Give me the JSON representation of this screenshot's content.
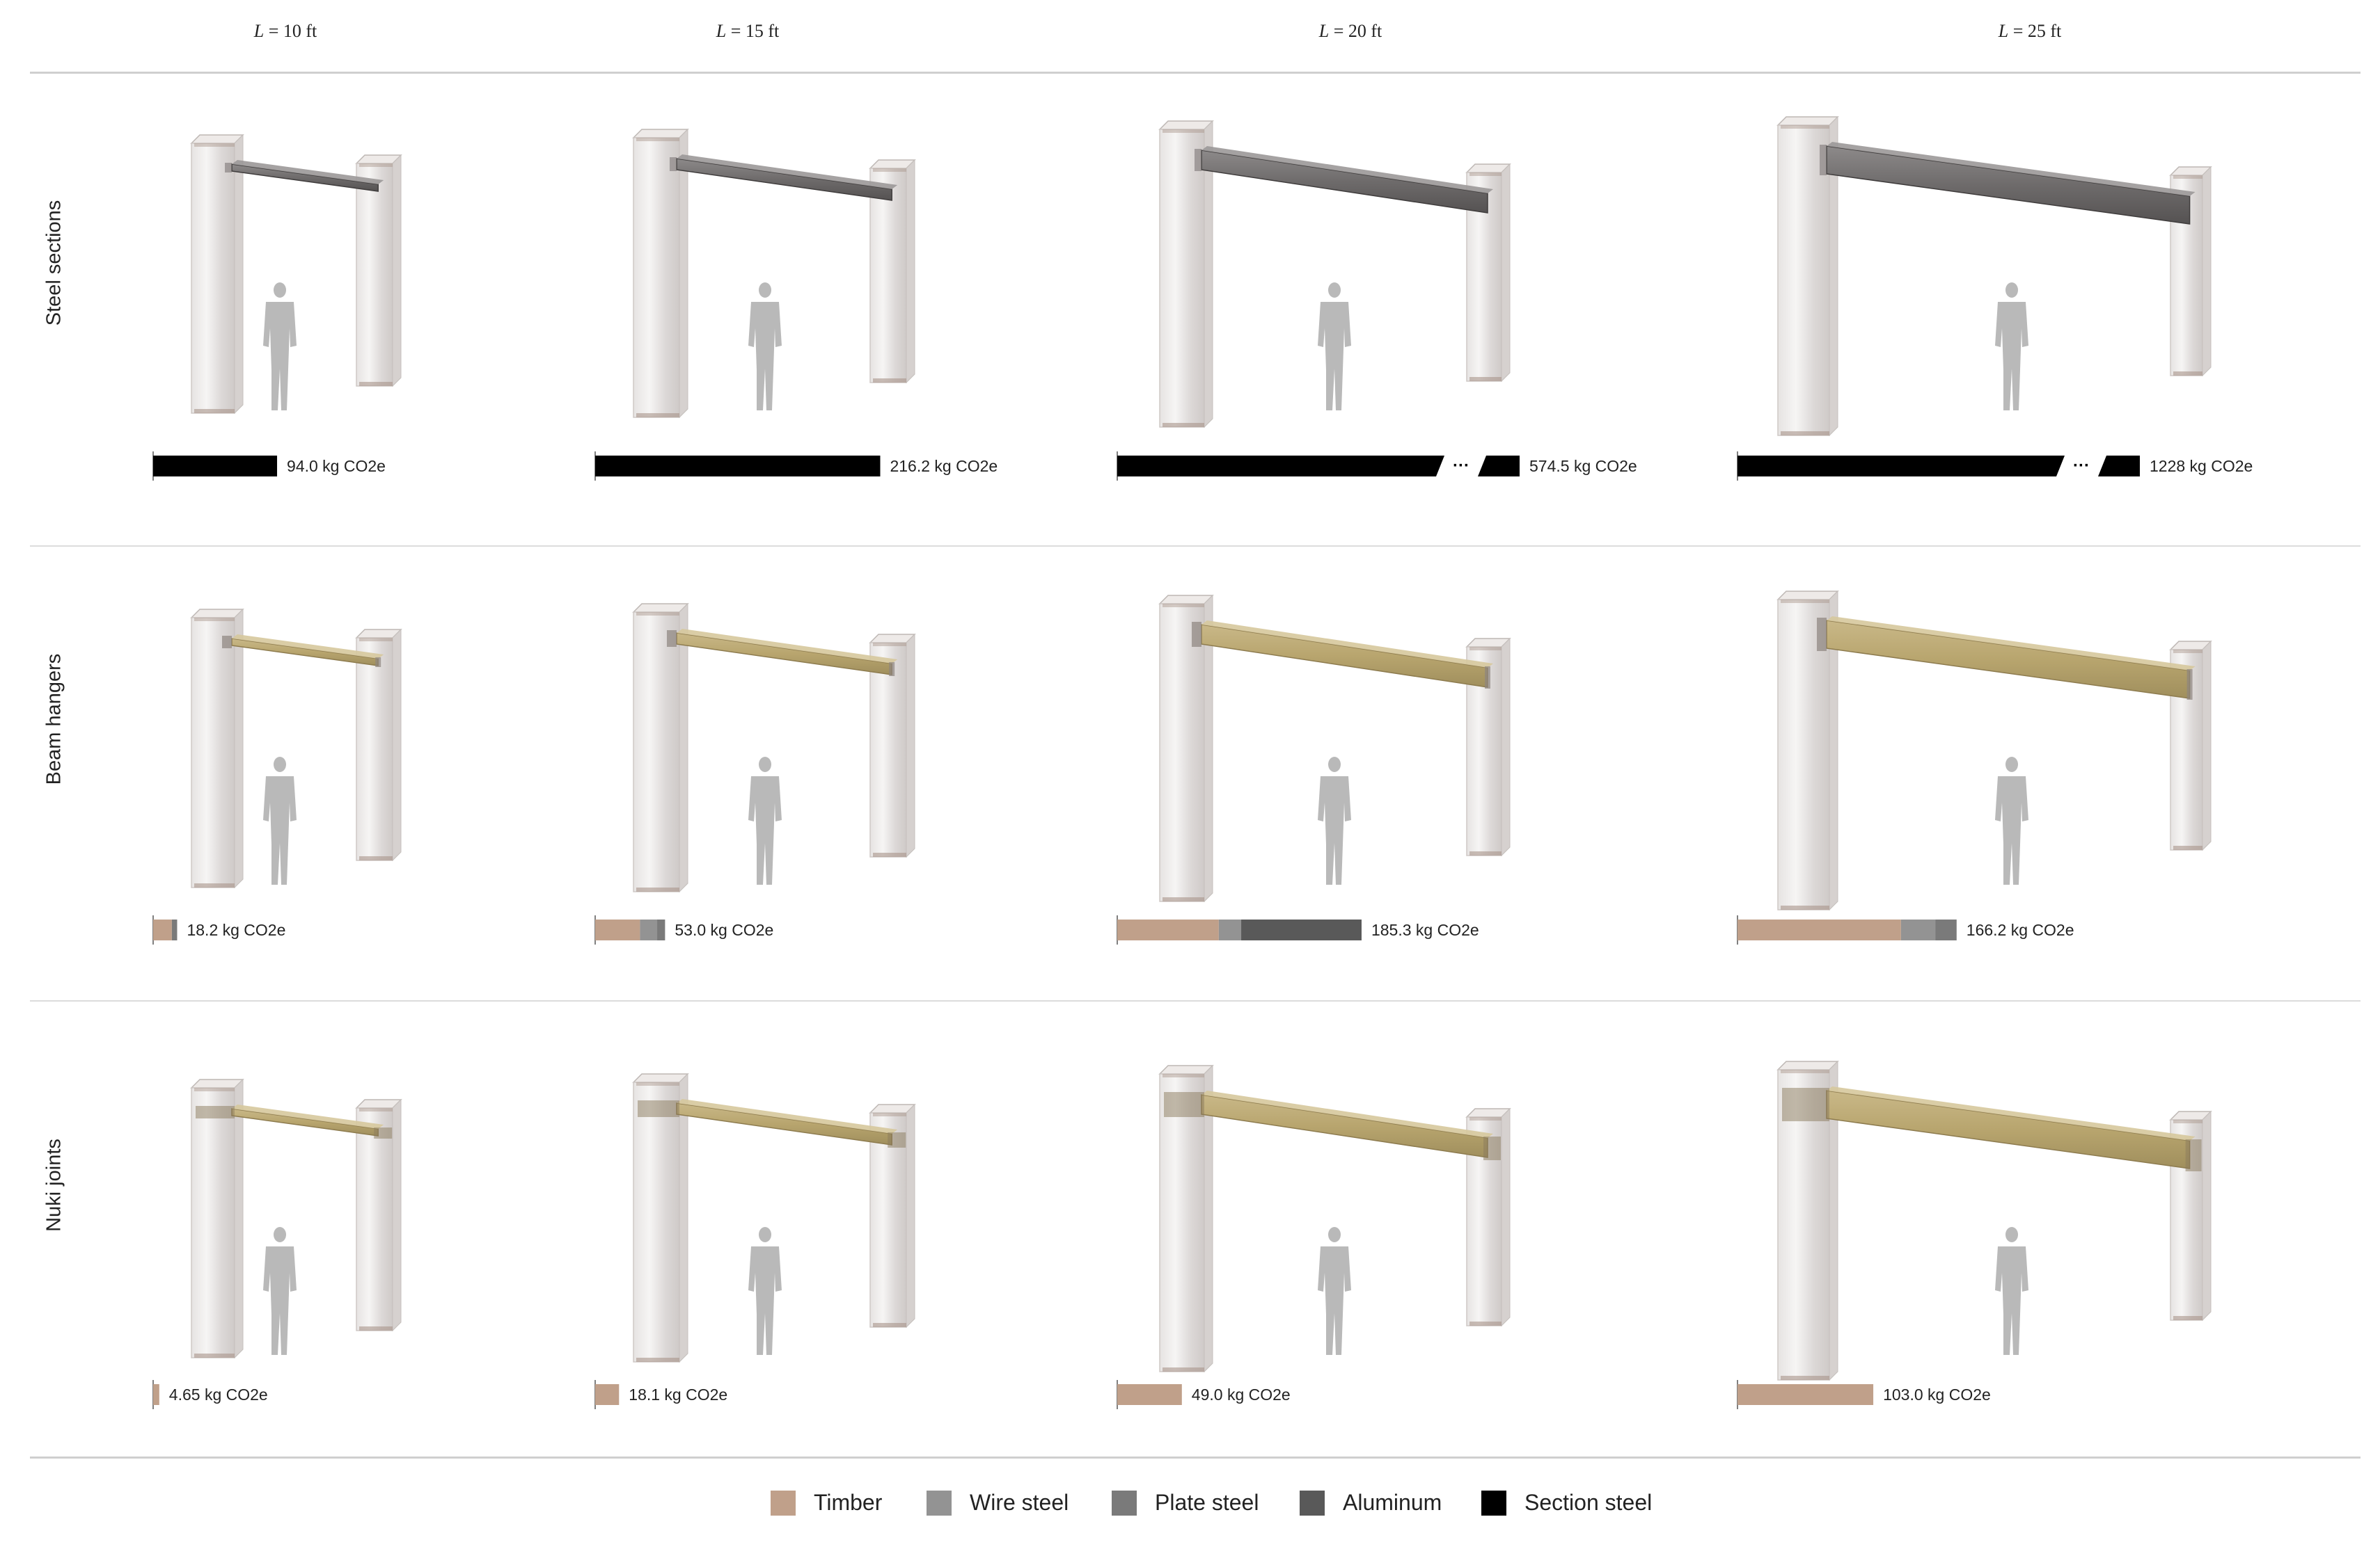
{
  "chart_data": {
    "type": "bar",
    "title": "",
    "columns": [
      {
        "prefix": "L",
        "value": " = 10 ft"
      },
      {
        "prefix": "L",
        "value": " = 15 ft"
      },
      {
        "prefix": "L",
        "value": " = 20 ft"
      },
      {
        "prefix": "L",
        "value": " = 25 ft"
      }
    ],
    "rows": [
      {
        "label": "Steel sections",
        "cells": [
          {
            "total_label": "94.0 kg CO2e",
            "segments": [
              {
                "material": "Section steel",
                "value": 94.0
              }
            ],
            "broken": false
          },
          {
            "total_label": "216.2 kg CO2e",
            "segments": [
              {
                "material": "Section steel",
                "value": 216.2
              }
            ],
            "broken": false
          },
          {
            "total_label": "574.5 kg CO2e",
            "segments": [
              {
                "material": "Section steel",
                "value": 574.5
              }
            ],
            "broken": true
          },
          {
            "total_label": "1228 kg CO2e",
            "segments": [
              {
                "material": "Section steel",
                "value": 1228
              }
            ],
            "broken": true
          }
        ]
      },
      {
        "label": "Beam hangers",
        "cells": [
          {
            "total_label": "18.2 kg CO2e",
            "segments": [
              {
                "material": "Timber",
                "value": 14.2
              },
              {
                "material": "Plate steel",
                "value": 4.0
              }
            ],
            "broken": false
          },
          {
            "total_label": "53.0 kg CO2e",
            "segments": [
              {
                "material": "Timber",
                "value": 34.0
              },
              {
                "material": "Wire steel",
                "value": 13.0
              },
              {
                "material": "Plate steel",
                "value": 6.0
              }
            ],
            "broken": false
          },
          {
            "total_label": "185.3 kg CO2e",
            "segments": [
              {
                "material": "Timber",
                "value": 77.0
              },
              {
                "material": "Wire steel",
                "value": 17.0
              },
              {
                "material": "Aluminum",
                "value": 91.3
              }
            ],
            "broken": false
          },
          {
            "total_label": "166.2 kg CO2e",
            "segments": [
              {
                "material": "Timber",
                "value": 124.0
              },
              {
                "material": "Wire steel",
                "value": 26.0
              },
              {
                "material": "Plate steel",
                "value": 16.2
              }
            ],
            "broken": false
          }
        ]
      },
      {
        "label": "Nuki joints",
        "cells": [
          {
            "total_label": "4.65 kg CO2e",
            "segments": [
              {
                "material": "Timber",
                "value": 4.65
              }
            ],
            "broken": false
          },
          {
            "total_label": "18.1 kg CO2e",
            "segments": [
              {
                "material": "Timber",
                "value": 18.1
              }
            ],
            "broken": false
          },
          {
            "total_label": "49.0 kg CO2e",
            "segments": [
              {
                "material": "Timber",
                "value": 49.0
              }
            ],
            "broken": false
          },
          {
            "total_label": "103.0 kg CO2e",
            "segments": [
              {
                "material": "Timber",
                "value": 103.0
              }
            ],
            "broken": false
          }
        ]
      }
    ],
    "beam_materials": [
      "steel",
      "timber",
      "timber"
    ],
    "legend": [
      {
        "name": "Timber",
        "color": "#c0a08a"
      },
      {
        "name": "Wire steel",
        "color": "#939393"
      },
      {
        "name": "Plate steel",
        "color": "#7a7a7a"
      },
      {
        "name": "Aluminum",
        "color": "#595959"
      },
      {
        "name": "Section steel",
        "color": "#000000"
      }
    ],
    "ellipsis": "···",
    "grid": false
  }
}
